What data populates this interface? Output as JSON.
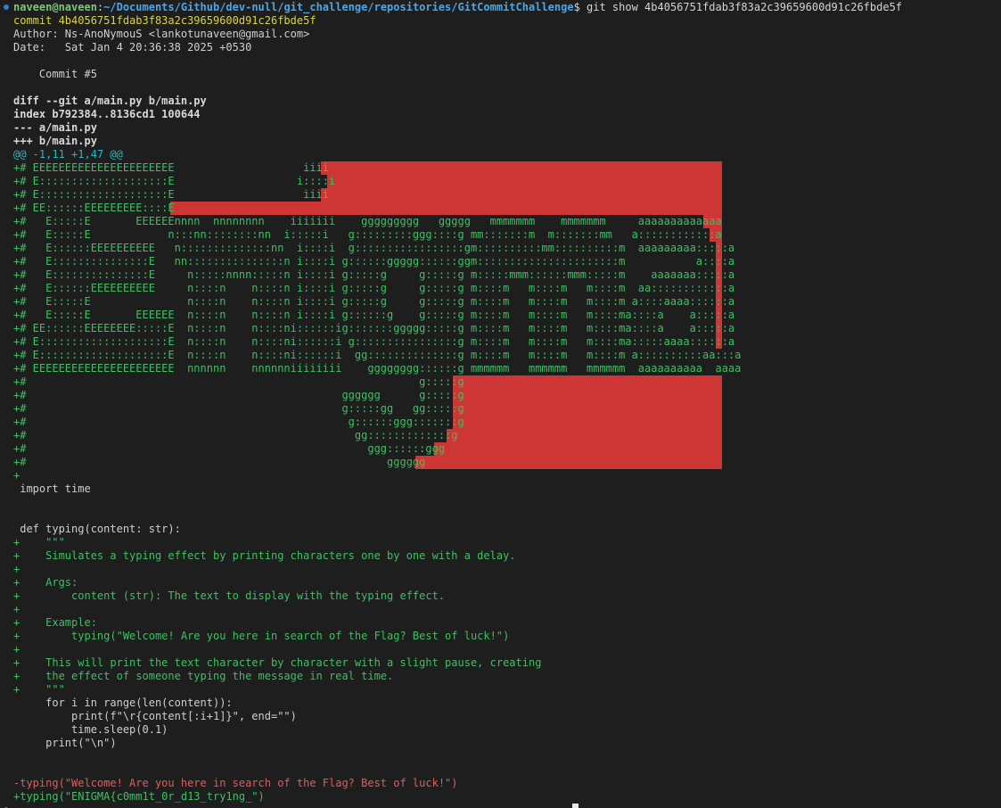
{
  "prompt": {
    "user": "naveen@naveen",
    "colon": ":",
    "path": "~/Documents/Github/dev-null/git_challenge/repositories/GitCommitChallenge",
    "dollar": "$",
    "command": " git show 4b4056751fdab3f83a2c39659600d91c26fbde5f"
  },
  "commit": {
    "hash_line": "commit 4b4056751fdab3f83a2c39659600d91c26fbde5f",
    "author_line": "Author: Ns-AnoNymouS <lankotunaveen@gmail.com>",
    "date_line": "Date:   Sat Jan 4 20:36:38 2025 +0530",
    "message_line": "    Commit #5"
  },
  "diff_header": [
    "diff --git a/main.py b/main.py",
    "index b792384..8136cd1 100644",
    "--- a/main.py",
    "+++ b/main.py"
  ],
  "hunk": "@@ -1,11 +1,47 @@",
  "banner_lines": [
    "+# EEEEEEEEEEEEEEEEEEEEEE                    iiii",
    "+# E::::::::::::::::::::E                   i::::i",
    "+# E::::::::::::::::::::E                    iiii",
    "+# EE::::::EEEEEEEEE::::E",
    "+#   E:::::E       EEEEEEnnnn  nnnnnnnn    iiiiiii    ggggggggg   ggggg   mmmmmmm    mmmmmmm     aaaaaaaaaaaaa",
    "+#   E:::::E            n:::nn::::::::nn  i:::::i   g:::::::::ggg::::g mm:::::::m  m:::::::mm   a::::::::::::a",
    "+#   E::::::EEEEEEEEEE   n::::::::::::::nn  i::::i  g:::::::::::::::::gm::::::::::mm::::::::::m  aaaaaaaaa:::::a",
    "+#   E:::::::::::::::E   nn:::::::::::::::n i::::i g::::::ggggg::::::ggm::::::::::::::::::::::m           a::::a",
    "+#   E:::::::::::::::E     n:::::nnnn:::::n i::::i g:::::g     g:::::g m:::::mmm::::::mmm:::::m    aaaaaaa:::::a",
    "+#   E::::::EEEEEEEEEE     n::::n    n::::n i::::i g:::::g     g:::::g m::::m   m::::m   m::::m  aa::::::::::::a",
    "+#   E:::::E               n::::n    n::::n i::::i g:::::g     g:::::g m::::m   m::::m   m::::m a::::aaaa::::::a",
    "+#   E:::::E       EEEEEE  n::::n    n::::n i::::i g::::::g    g:::::g m::::m   m::::m   m::::ma::::a    a:::::a",
    "+# EE::::::EEEEEEEE:::::E  n::::n    n::::ni::::::ig:::::::ggggg:::::g m::::m   m::::m   m::::ma::::a    a:::::a",
    "+# E::::::::::::::::::::E  n::::n    n::::ni::::::i g::::::::::::::::g m::::m   m::::m   m::::ma:::::aaaa::::::a",
    "+# E::::::::::::::::::::E  n::::n    n::::ni::::::i  gg::::::::::::::g m::::m   m::::m   m::::m a::::::::::aa:::a",
    "+# EEEEEEEEEEEEEEEEEEEEEE  nnnnnn    nnnnnniiiiiiii    gggggggg::::::g mmmmmm   mmmmmm   mmmmmm  aaaaaaaaaa  aaaa",
    "+#                                                             g:::::g",
    "+#                                                 gggggg      g:::::g",
    "+#                                                 g:::::gg   gg:::::g",
    "+#                                                  g::::::ggg:::::::g",
    "+#                                                   gg:::::::::::::g",
    "+#                                                     ggg::::::ggg",
    "+#                                                        gggggg"
  ],
  "code_lines": [
    {
      "text": "+",
      "kind": "added"
    },
    {
      "text": " import time",
      "kind": "context"
    },
    {
      "text": "",
      "kind": "context"
    },
    {
      "text": "",
      "kind": "context"
    },
    {
      "text": " def typing(content: str):",
      "kind": "context"
    },
    {
      "text": "+    \"\"\"",
      "kind": "added"
    },
    {
      "text": "+    Simulates a typing effect by printing characters one by one with a delay.",
      "kind": "added"
    },
    {
      "text": "+",
      "kind": "added"
    },
    {
      "text": "+    Args:",
      "kind": "added"
    },
    {
      "text": "+        content (str): The text to display with the typing effect.",
      "kind": "added"
    },
    {
      "text": "+",
      "kind": "added"
    },
    {
      "text": "+    Example:",
      "kind": "added"
    },
    {
      "text": "+        typing(\"Welcome! Are you here in search of the Flag? Best of luck!\")",
      "kind": "added"
    },
    {
      "text": "+",
      "kind": "added"
    },
    {
      "text": "+    This will print the text character by character with a slight pause, creating",
      "kind": "added"
    },
    {
      "text": "+    the effect of someone typing the message in real time.",
      "kind": "added"
    },
    {
      "text": "+    \"\"\"",
      "kind": "added"
    },
    {
      "text": "     for i in range(len(content)):",
      "kind": "context"
    },
    {
      "text": "         print(f\"\\r{content[:i+1]}\", end=\"\")",
      "kind": "context"
    },
    {
      "text": "         time.sleep(0.1)",
      "kind": "context"
    },
    {
      "text": "     print(\"\\n\")",
      "kind": "context"
    },
    {
      "text": "",
      "kind": "context"
    },
    {
      "text": "",
      "kind": "context"
    },
    {
      "text": "-typing(\"Welcome! Are you here in search of the Flag? Best of luck!\")",
      "kind": "removed"
    },
    {
      "text": "+typing(\"ENIGMA{c0mm1t_0r_d13_try1ng_\")",
      "kind": "added"
    }
  ],
  "colors": {
    "background": "#1e1e1e",
    "added": "#3fbf62",
    "removed": "#e05c5c",
    "hunk": "#27b6c2",
    "commit_hash": "#d7d34a",
    "trailing_whitespace": "#ce3535"
  }
}
